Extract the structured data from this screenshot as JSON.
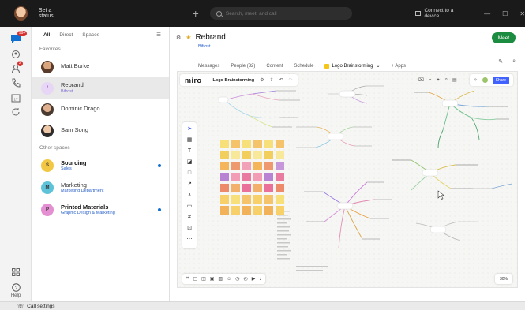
{
  "titlebar": {
    "status": "Set a status",
    "search_placeholder": "Search, meet, and call",
    "connect": "Connect to a device"
  },
  "rail": {
    "badge_count": "99+",
    "badge2": "2",
    "help": "Help"
  },
  "sidebar": {
    "tabs": [
      "All",
      "Direct",
      "Spaces"
    ],
    "favorites_label": "Favorites",
    "other_label": "Other spaces",
    "favorites": [
      {
        "name": "Matt Burke",
        "sub": ""
      },
      {
        "name": "Rebrand",
        "sub": "Bifrost"
      },
      {
        "name": "Dominic Drago",
        "sub": ""
      },
      {
        "name": "Sam Song",
        "sub": ""
      }
    ],
    "other": [
      {
        "initial": "S",
        "name": "Sourcing",
        "sub": "Sales",
        "color": "#f2c744"
      },
      {
        "initial": "M",
        "name": "Marketing",
        "sub": "Marketing Department",
        "color": "#5ec2d9"
      },
      {
        "initial": "P",
        "name": "Printed Materials",
        "sub": "Graphic Design & Marketing",
        "color": "#e38fd1"
      }
    ]
  },
  "main": {
    "title": "Rebrand",
    "subtitle": "Bifrost",
    "meet_label": "Meet",
    "tabs": [
      "Messages",
      "People (32)",
      "Content",
      "Schedule",
      "Logo Brainstorming",
      "+ Apps"
    ]
  },
  "miro": {
    "logo": "miro",
    "board_name": "Logo Brainstorming",
    "share_label": "Share",
    "zoom": "30%"
  },
  "colors": {
    "accent_meet": "#1c8c40",
    "miro_blue": "#4262ff",
    "badge_red": "#d5322f"
  },
  "statusbar": {
    "call_settings": "Call settings"
  }
}
